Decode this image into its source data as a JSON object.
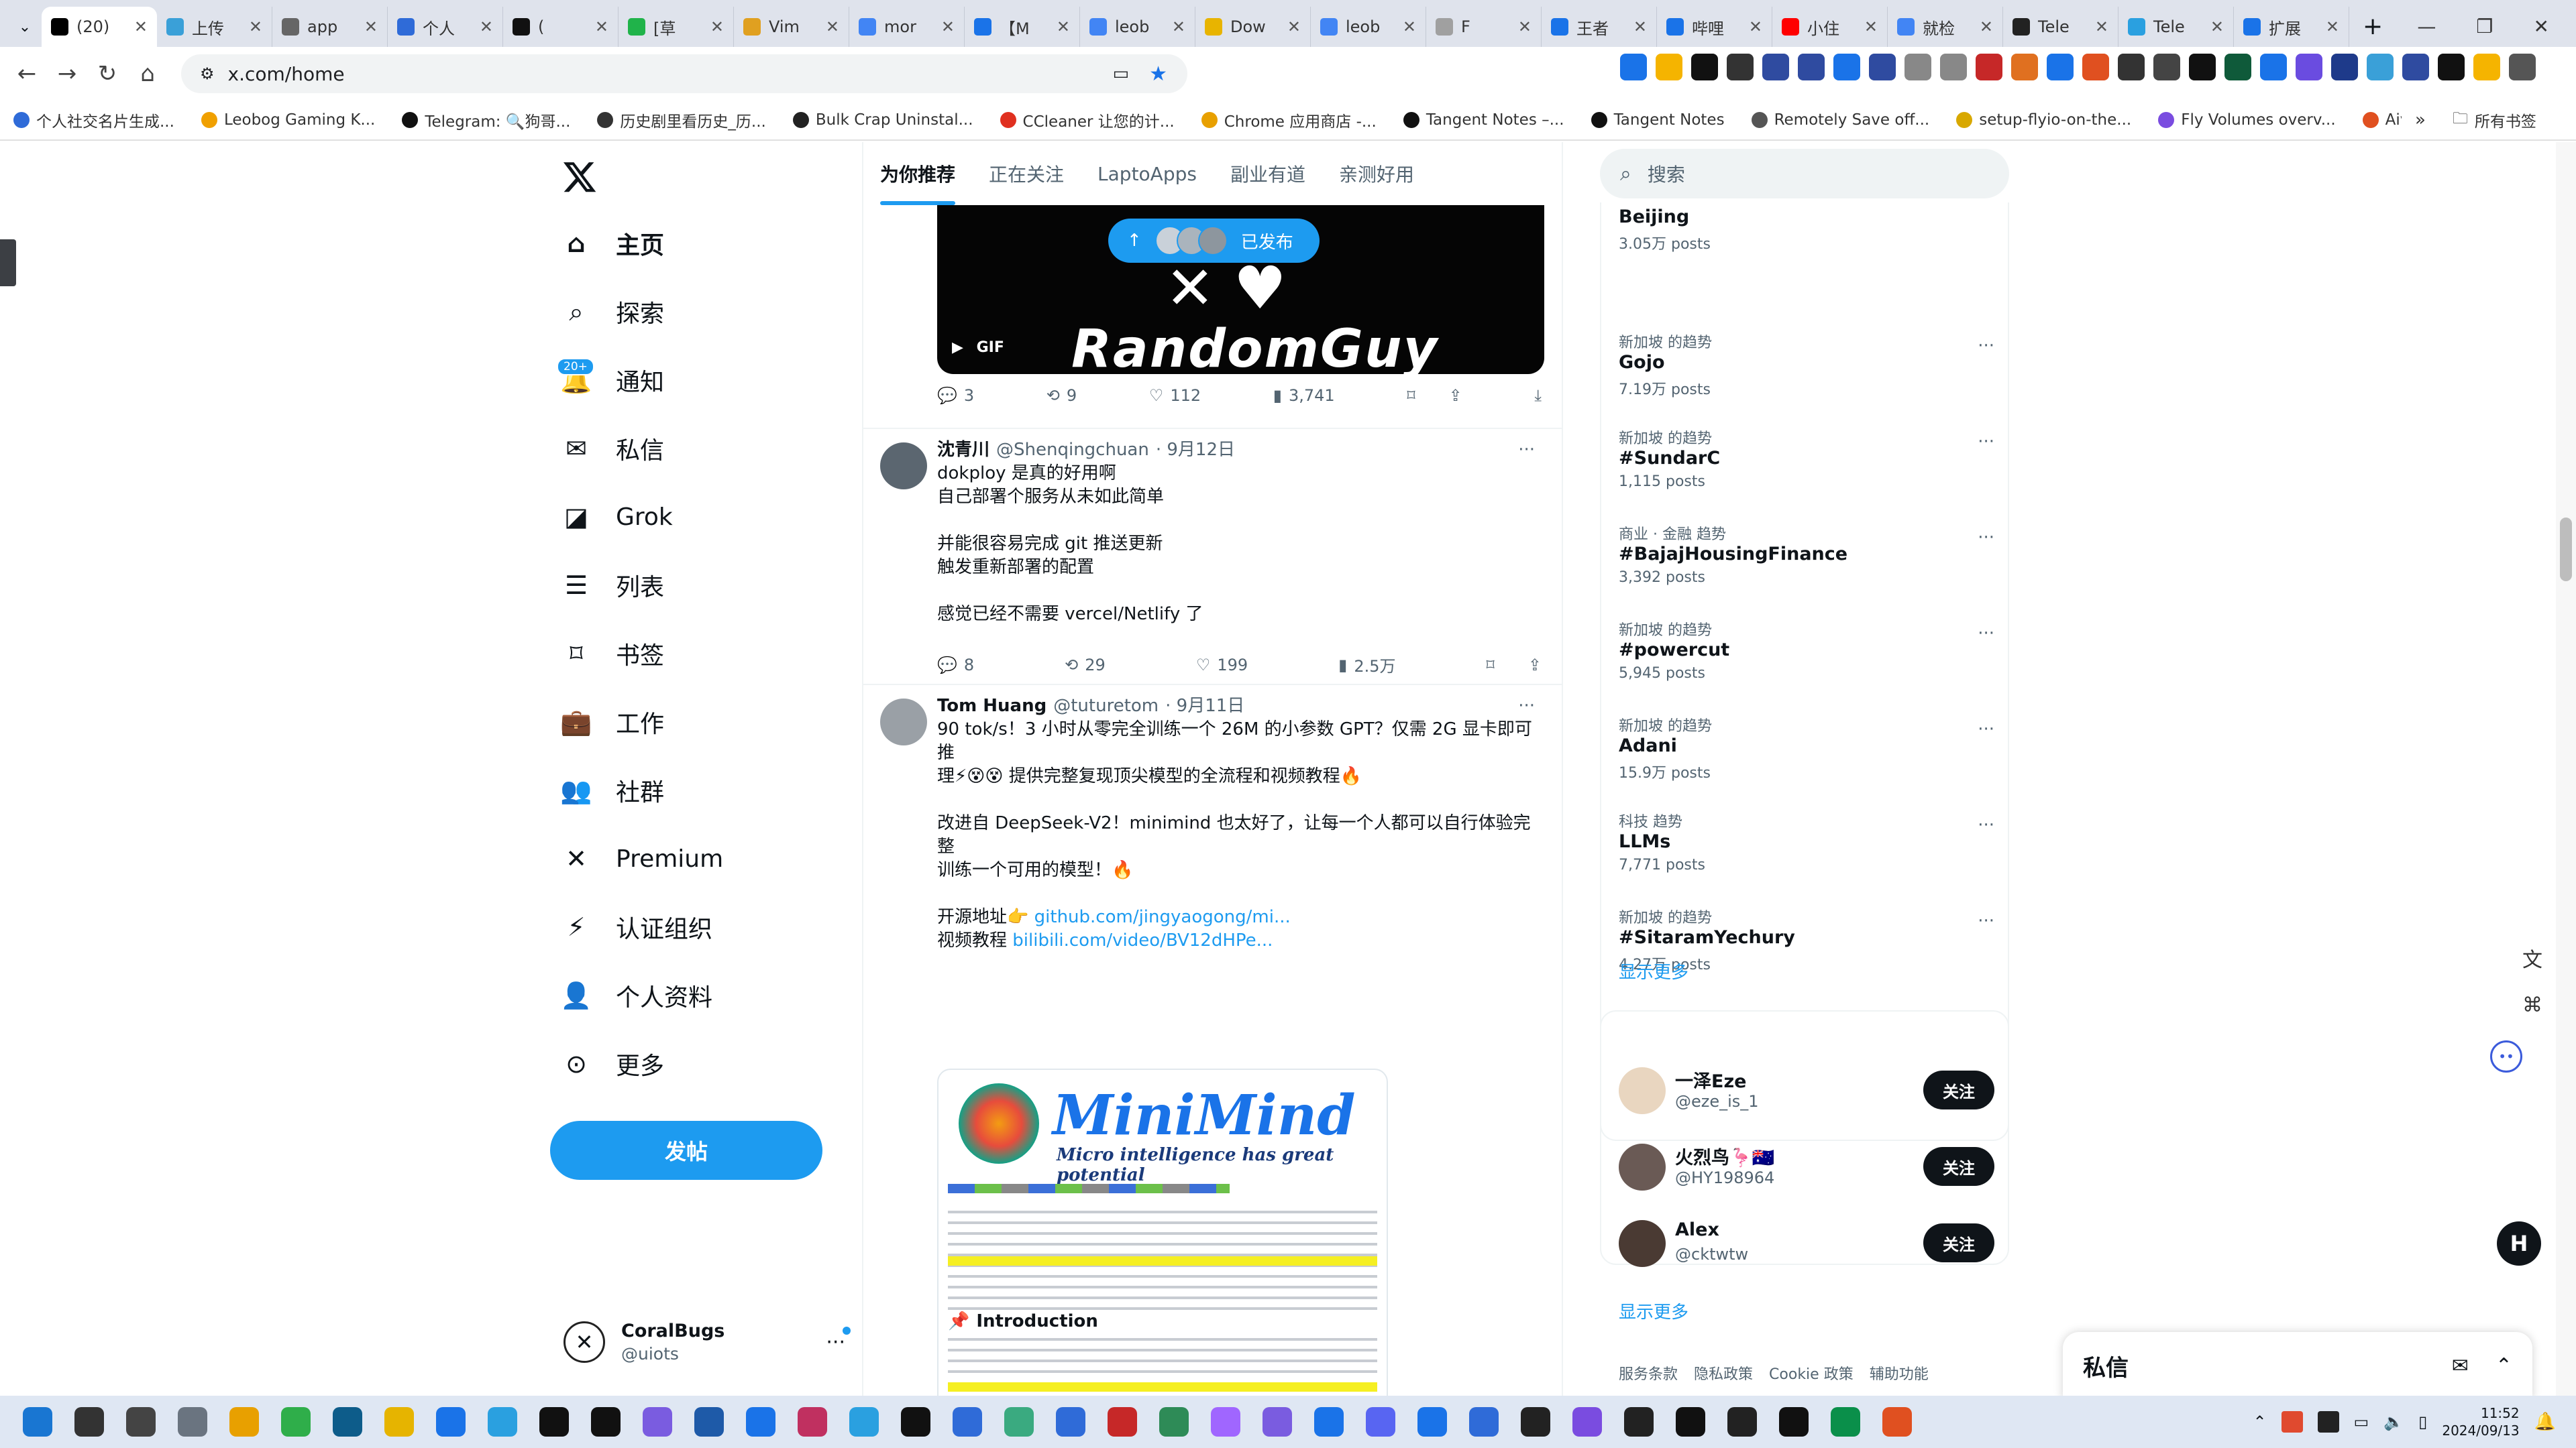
{
  "tabs": [
    {
      "label": "(20)",
      "color": "#000000",
      "active": true
    },
    {
      "label": "上传",
      "color": "#3aa0d8"
    },
    {
      "label": "app",
      "color": "#666666"
    },
    {
      "label": "个人",
      "color": "#2f6bd8"
    },
    {
      "label": "(",
      "color": "#111111"
    },
    {
      "label": "[草",
      "color": "#20b34a"
    },
    {
      "label": "Vim",
      "color": "#e0a020"
    },
    {
      "label": "mor",
      "color": "#4285f4"
    },
    {
      "label": "【M",
      "color": "#1a73e8"
    },
    {
      "label": "leob",
      "color": "#4285f4"
    },
    {
      "label": "Dow",
      "color": "#e8b400"
    },
    {
      "label": "leob",
      "color": "#4285f4"
    },
    {
      "label": "F",
      "color": "#a0a0a0"
    },
    {
      "label": "王者",
      "color": "#1a73e8"
    },
    {
      "label": "哔哩",
      "color": "#1a73e8"
    },
    {
      "label": "小住",
      "color": "#ff0000"
    },
    {
      "label": "就检",
      "color": "#4285f4"
    },
    {
      "label": "Tele",
      "color": "#222222"
    },
    {
      "label": "Tele",
      "color": "#2aa0e0"
    },
    {
      "label": "扩展",
      "color": "#1a73e8"
    }
  ],
  "url": "x.com/home",
  "bookmarks": [
    {
      "label": "个人社交名片生成...",
      "color": "#2f6bd8"
    },
    {
      "label": "Leobog Gaming K...",
      "color": "#f0a000"
    },
    {
      "label": "Telegram: 🔍狗哥...",
      "color": "#111111"
    },
    {
      "label": "历史剧里看历史_历...",
      "color": "#333333"
    },
    {
      "label": "Bulk Crap Uninstal...",
      "color": "#222222"
    },
    {
      "label": "CCleaner 让您的计...",
      "color": "#e03020"
    },
    {
      "label": "Chrome 应用商店 -...",
      "color": "#e8a000"
    },
    {
      "label": "Tangent Notes –...",
      "color": "#111111"
    },
    {
      "label": "Tangent Notes",
      "color": "#111111"
    },
    {
      "label": "Remotely Save off...",
      "color": "#555555"
    },
    {
      "label": "setup-flyio-on-the...",
      "color": "#d8a800"
    },
    {
      "label": "Fly Volumes overv...",
      "color": "#7a4ce0"
    },
    {
      "label": "Aiven Plans and P...",
      "color": "#e05020"
    }
  ],
  "bookmarks_all": "所有书签",
  "nav": {
    "items": [
      {
        "label": "主页",
        "icon": "home-icon",
        "bold": true
      },
      {
        "label": "探索",
        "icon": "search-icon"
      },
      {
        "label": "通知",
        "icon": "bell-icon",
        "badge": "20+"
      },
      {
        "label": "私信",
        "icon": "mail-icon"
      },
      {
        "label": "Grok",
        "icon": "grok-icon"
      },
      {
        "label": "列表",
        "icon": "list-icon"
      },
      {
        "label": "书签",
        "icon": "bookmark-icon"
      },
      {
        "label": "工作",
        "icon": "briefcase-icon"
      },
      {
        "label": "社群",
        "icon": "community-icon"
      },
      {
        "label": "Premium",
        "icon": "x-logo-icon"
      },
      {
        "label": "认证组织",
        "icon": "bolt-icon"
      },
      {
        "label": "个人资料",
        "icon": "person-icon"
      },
      {
        "label": "更多",
        "icon": "more-circle-icon"
      }
    ],
    "post_label": "发帖",
    "account_name": "CoralBugs",
    "account_handle": "@uiots"
  },
  "timeline": {
    "tabs": [
      "为你推荐",
      "正在关注",
      "LaptoApps",
      "副业有道",
      "亲测好用"
    ],
    "published_pill": "已发布",
    "gif_label": "GIF",
    "gif_text": "RandomGuy",
    "first_actions": {
      "reply": "3",
      "retweet": "9",
      "like": "112",
      "views": "3,741"
    },
    "tweets": [
      {
        "name": "沈青川",
        "handle": "@Shenqingchuan",
        "date": "· 9月12日",
        "lines": [
          "dokploy 是真的好用啊",
          "自己部署个服务从未如此简单",
          "",
          "并能很容易完成 git 推送更新",
          "触发重新部署的配置",
          "",
          "感觉已经不需要 vercel/Netlify 了"
        ],
        "reply": "8",
        "retweet": "29",
        "like": "199",
        "views": "2.5万"
      },
      {
        "name": "Tom Huang",
        "handle": "@tuturetom",
        "date": "· 9月11日",
        "lines": [
          "90 tok/s！3 小时从零完全训练一个 26M 的小参数 GPT？仅需 2G 显卡即可推",
          "理⚡😵😵 提供完整复现顶尖模型的全流程和视频教程🔥",
          "",
          "改进自 DeepSeek-V2！minimind 也太好了，让每一个人都可以自行体验完整",
          "训练一个可用的模型！🔥",
          ""
        ],
        "link1_prefix": "开源地址👉 ",
        "link1": "github.com/jingyaogong/mi...",
        "link2_prefix": "视频教程 ",
        "link2": "bilibili.com/video/BV12dHPe...",
        "card_title": "MiniMind",
        "card_subtitle": "Micro intelligence has great potential",
        "card_section": "Introduction"
      }
    ]
  },
  "sidebar": {
    "search_placeholder": "搜索",
    "trends": [
      {
        "category": "",
        "title": "Beijing",
        "count": "3.05万 posts"
      },
      {
        "category": "新加坡 的趋势",
        "title": "Gojo",
        "count": "7.19万 posts"
      },
      {
        "category": "新加坡 的趋势",
        "title": "#SundarC",
        "count": "1,115 posts"
      },
      {
        "category": "商业 · 金融 趋势",
        "title": "#BajajHousingFinance",
        "count": "3,392 posts"
      },
      {
        "category": "新加坡 的趋势",
        "title": "#powercut",
        "count": "5,945 posts"
      },
      {
        "category": "新加坡 的趋势",
        "title": "Adani",
        "count": "15.9万 posts"
      },
      {
        "category": "科技 趋势",
        "title": "LLMs",
        "count": "7,771 posts"
      },
      {
        "category": "新加坡 的趋势",
        "title": "#SitaramYechury",
        "count": "4.27万 posts"
      }
    ],
    "show_more": "显示更多",
    "who_to_follow": [
      {
        "name": "一泽Eze",
        "handle": "@eze_is_1",
        "avatar_color": "#e9d6c0"
      },
      {
        "name": "火烈鸟🦩🇦🇺",
        "handle": "@HY198964",
        "avatar_color": "#6a5a55"
      },
      {
        "name": "Alex",
        "handle": "@cktwtw",
        "avatar_color": "#4a3a33"
      }
    ],
    "follow_label": "关注",
    "show_more2": "显示更多",
    "footer": [
      "服务条款",
      "隐私政策",
      "Cookie 政策",
      "辅助功能"
    ]
  },
  "dm_drawer": {
    "title": "私信"
  },
  "clock": {
    "time": "11:52",
    "date": "2024/09/13"
  }
}
